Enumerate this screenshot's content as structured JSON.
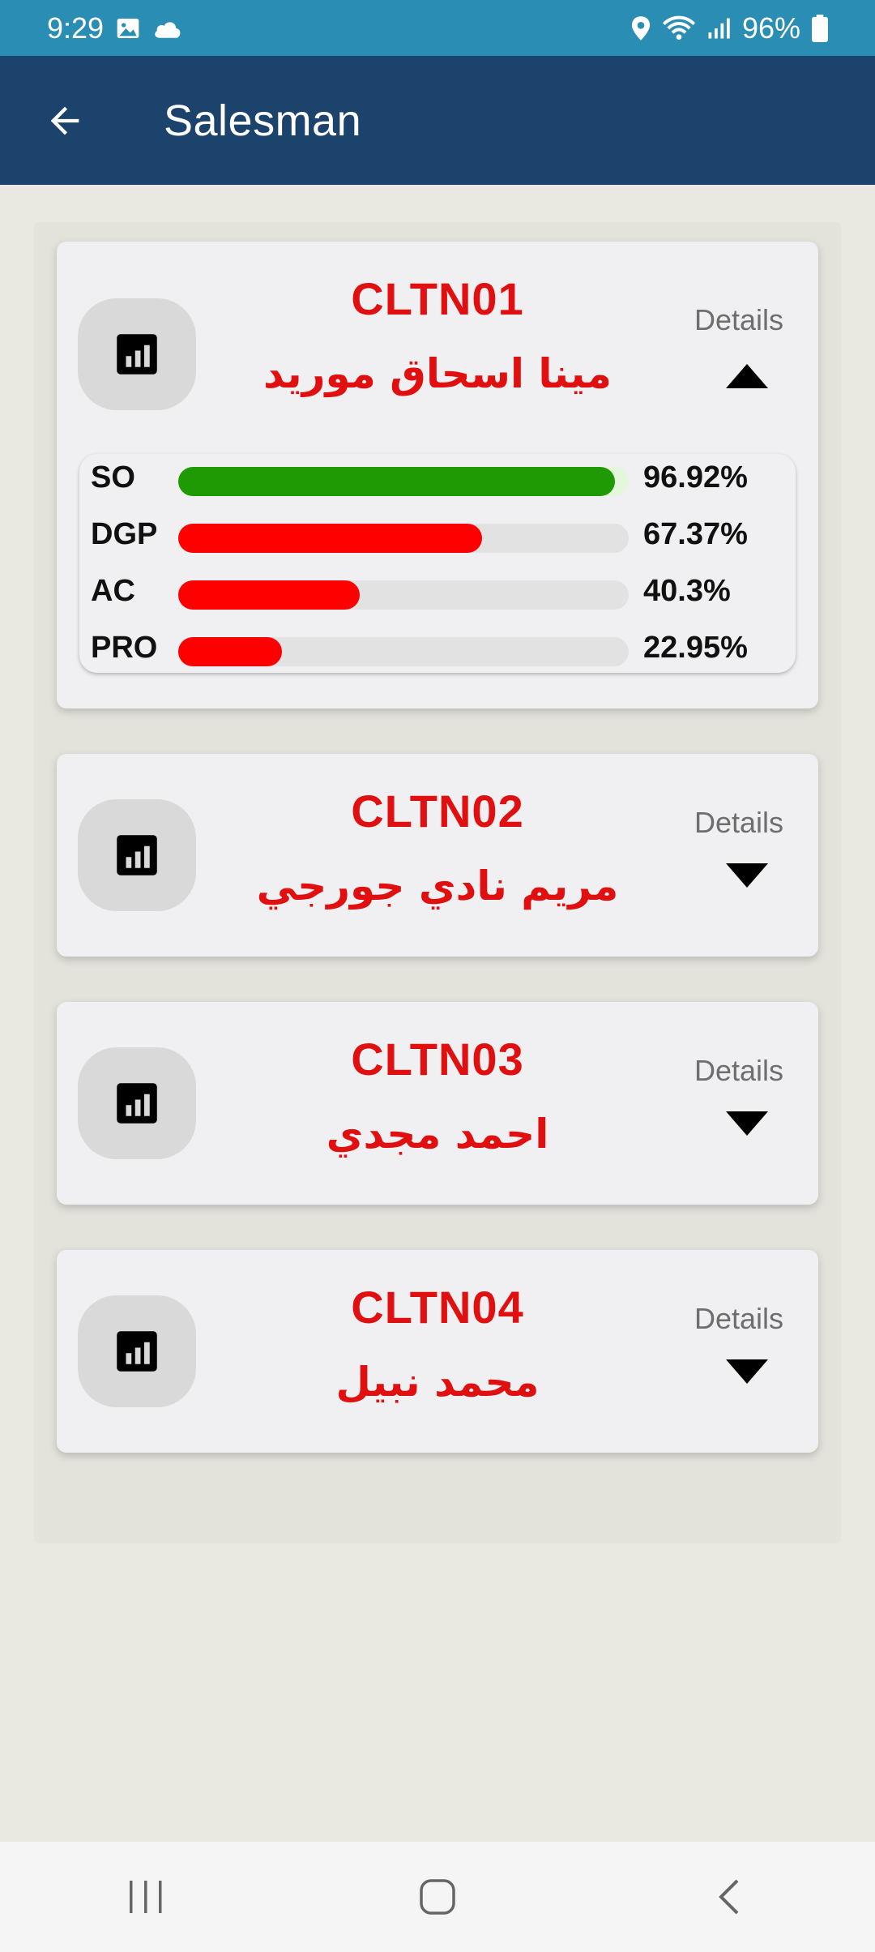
{
  "status_bar": {
    "time": "9:29",
    "battery_text": "96%",
    "icons_left": [
      "image-icon",
      "cloud-icon"
    ],
    "icons_right": [
      "location-icon",
      "wifi-icon",
      "signal-icon",
      "battery-icon"
    ]
  },
  "app_bar": {
    "title": "Salesman",
    "back_icon": "arrow-left-icon"
  },
  "colors": {
    "app_bar": "#1c436c",
    "status_bar": "#2a8db3",
    "accent_red": "#e11010",
    "bar_green": "#1f9a05",
    "bar_red": "#ff0000"
  },
  "salesmen": [
    {
      "code": "CLTN01",
      "name": "مينا اسحاق موريد",
      "details_label": "Details",
      "expanded": true,
      "metrics": [
        {
          "label": "SO",
          "value": "96.92%",
          "percent": 96.92,
          "color": "#1f9a05"
        },
        {
          "label": "DGP",
          "value": "67.37%",
          "percent": 67.37,
          "color": "#ff0000"
        },
        {
          "label": "AC",
          "value": "40.3%",
          "percent": 40.3,
          "color": "#ff0000"
        },
        {
          "label": "PRO",
          "value": "22.95%",
          "percent": 22.95,
          "color": "#ff0000"
        }
      ]
    },
    {
      "code": "CLTN02",
      "name": "مريم نادي جورجي",
      "details_label": "Details",
      "expanded": false
    },
    {
      "code": "CLTN03",
      "name": "احمد مجدي",
      "details_label": "Details",
      "expanded": false
    },
    {
      "code": "CLTN04",
      "name": "محمد نبيل",
      "details_label": "Details",
      "expanded": false
    }
  ],
  "nav_bar": {
    "buttons": [
      "recent-apps-icon",
      "home-icon",
      "back-icon"
    ]
  }
}
